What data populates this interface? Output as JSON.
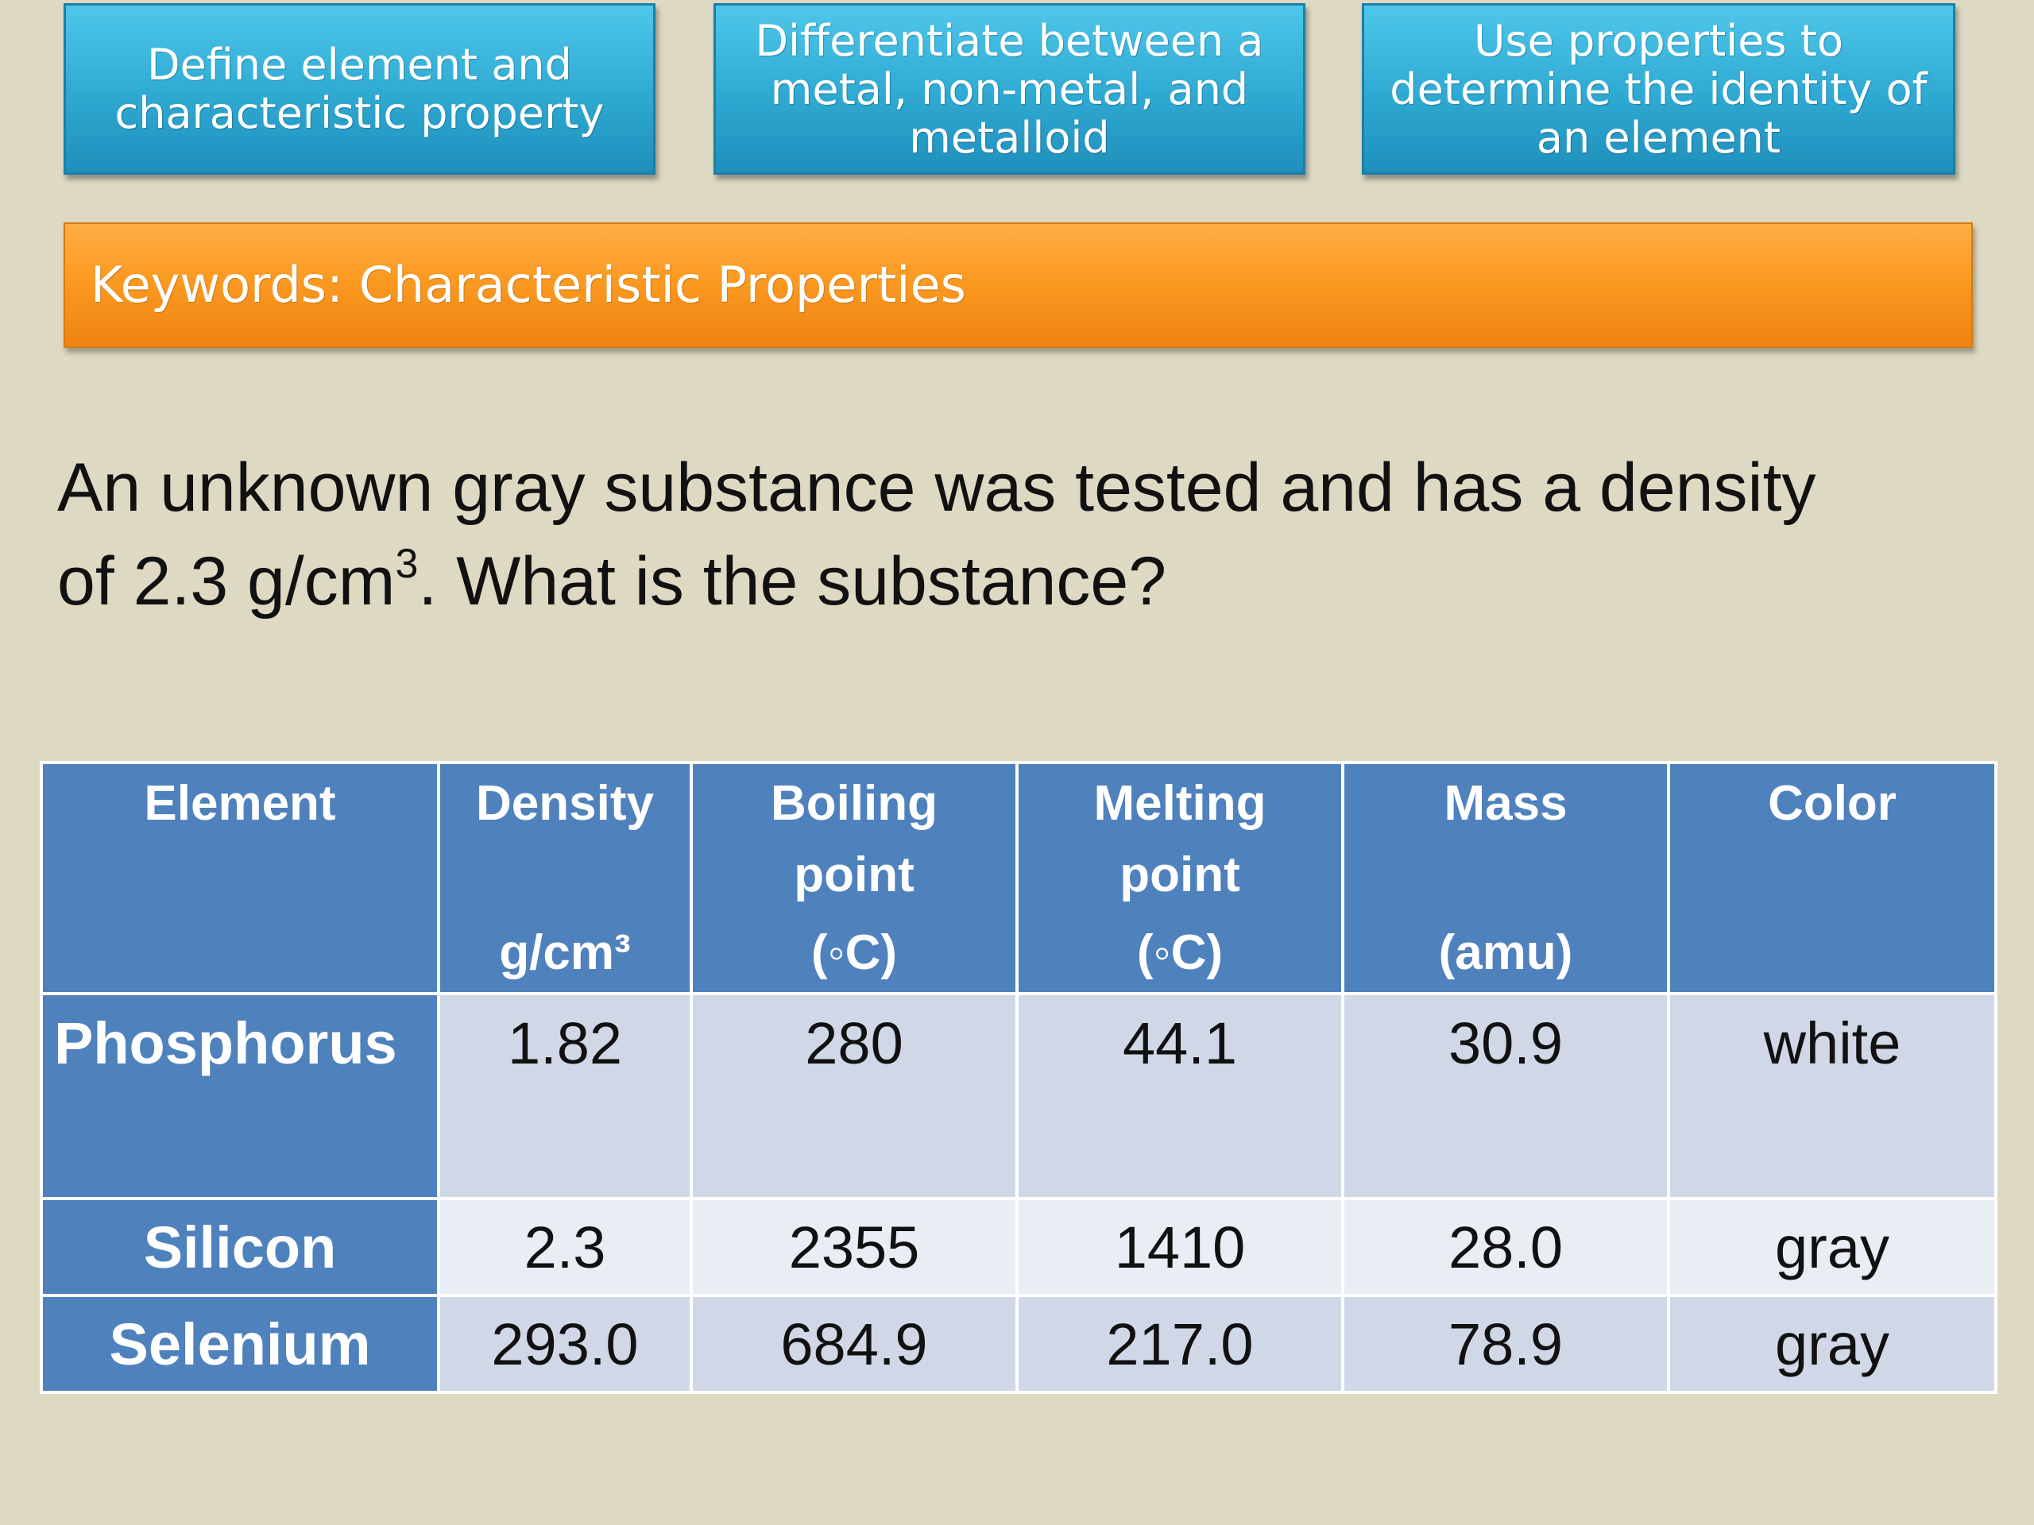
{
  "objectives": [
    {
      "lines": [
        "Define element and",
        "characteristic property"
      ]
    },
    {
      "lines": [
        "Differentiate between a",
        "metal, non-metal, and",
        "metalloid"
      ]
    },
    {
      "lines": [
        "Use properties to",
        "determine the identity of",
        "an element"
      ]
    }
  ],
  "keywords_label": "Keywords: Characteristic Properties",
  "question": {
    "line1": "An unknown gray substance was tested and has a density",
    "line2_before": "of 2.3 g/cm",
    "superscript": "3",
    "line2_after": ". What is the substance?"
  },
  "table": {
    "headers": [
      {
        "top": "Element",
        "bottom": ""
      },
      {
        "top": "Density",
        "bottom": "g/cm³"
      },
      {
        "top": "Boiling",
        "mid": "point",
        "bottom": "(◦C)"
      },
      {
        "top": "Melting",
        "mid": "point",
        "bottom": "(◦C)"
      },
      {
        "top": "Mass",
        "bottom": "(amu)"
      },
      {
        "top": "Color",
        "bottom": ""
      }
    ],
    "rows": [
      {
        "element": "Phosphorus",
        "density": "1.82",
        "boiling": "280",
        "melting": "44.1",
        "mass": "30.9",
        "color": "white"
      },
      {
        "element": "Silicon",
        "density": "2.3",
        "boiling": "2355",
        "melting": "1410",
        "mass": "28.0",
        "color": "gray"
      },
      {
        "element": "Selenium",
        "density": "293.0",
        "boiling": "684.9",
        "melting": "217.0",
        "mass": "78.9",
        "color": "gray"
      }
    ]
  },
  "colors": {
    "background": "#ddd9c3",
    "objective_box": "#2ea9d2",
    "keyword_bar": "#fb9a22",
    "table_header": "#4f81bd",
    "row_band_a": "#d0d8e8",
    "row_band_b": "#e9edf4"
  }
}
